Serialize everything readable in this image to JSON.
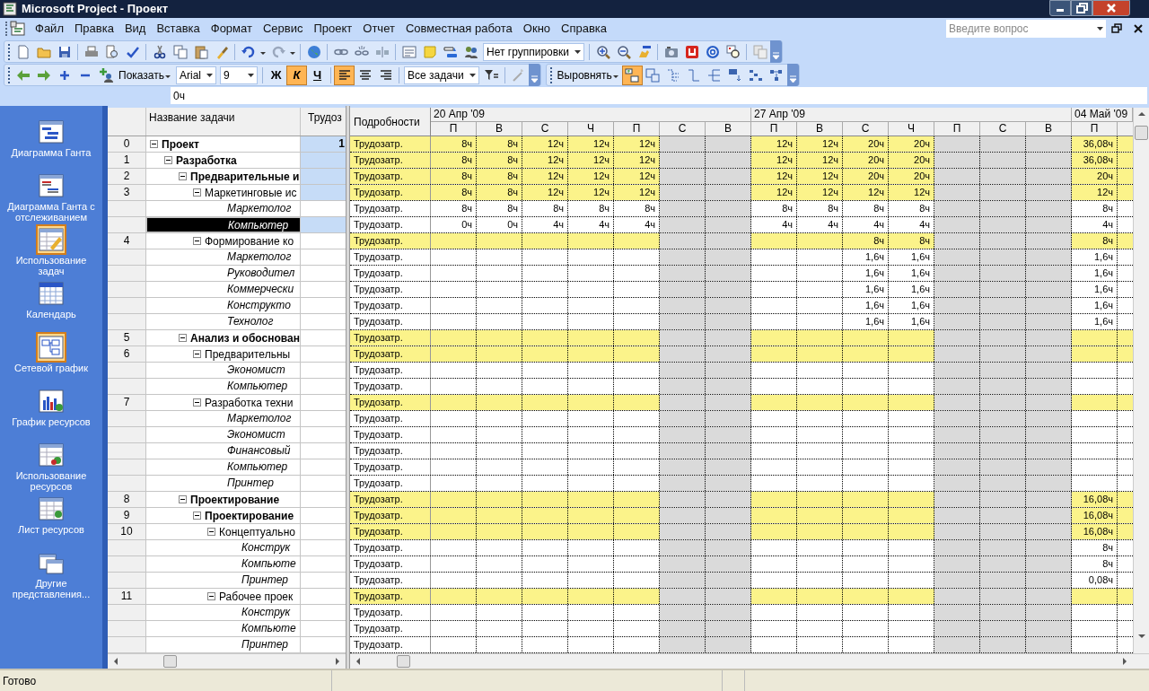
{
  "window": {
    "title": "Microsoft Project - Проект"
  },
  "menu": [
    "Файл",
    "Правка",
    "Вид",
    "Вставка",
    "Формат",
    "Сервис",
    "Проект",
    "Отчет",
    "Совместная работа",
    "Окно",
    "Справка"
  ],
  "help_search": {
    "placeholder": "Введите вопрос"
  },
  "standard_toolbar": {
    "grouping": "Нет группировки"
  },
  "formatting_toolbar": {
    "show_label": "Показать",
    "font": "Arial",
    "font_size": "9",
    "styles": [
      {
        "label": "Ж",
        "pressed": false
      },
      {
        "label": "К",
        "pressed": true
      },
      {
        "label": "Ч",
        "pressed": false
      }
    ],
    "alignment": [
      {
        "selected": true
      },
      {
        "selected": false
      },
      {
        "selected": false
      }
    ],
    "filter": "Все задачи"
  },
  "network_toolbar": {
    "align_label": "Выровнять",
    "tools": [
      {
        "pressed": true
      },
      {
        "pressed": false
      },
      {
        "pressed": false
      },
      {
        "pressed": false
      },
      {
        "pressed": false
      },
      {
        "pressed": false
      },
      {
        "pressed": false
      },
      {
        "pressed": false
      }
    ]
  },
  "entry_bar": {
    "value": "0ч"
  },
  "view_bar": [
    {
      "label": "Диаграмма Ганта",
      "selected": false
    },
    {
      "label": "Диаграмма Ганта с отслеживанием",
      "selected": false
    },
    {
      "label": "Использование задач",
      "selected": true
    },
    {
      "label": "Календарь",
      "selected": false
    },
    {
      "label": "Сетевой график",
      "selected": true
    },
    {
      "label": "График ресурсов",
      "selected": false
    },
    {
      "label": "Использование ресурсов",
      "selected": false
    },
    {
      "label": "Лист ресурсов",
      "selected": false
    },
    {
      "label": "Другие представления...",
      "selected": false
    }
  ],
  "table": {
    "columns": [
      "Название задачи",
      "Трудоз"
    ],
    "tasks": [
      {
        "kind": "task",
        "id": "0",
        "name": "Проект",
        "bold": true,
        "expanded": true,
        "highlighted": true,
        "selected": false,
        "work": "1",
        "detail": "Трудозатр.",
        "cells": [
          "8ч",
          "8ч",
          "12ч",
          "12ч",
          "12ч",
          null,
          null,
          "12ч",
          "12ч",
          "20ч",
          "20ч",
          null,
          null,
          null,
          "36,08ч"
        ],
        "children": [
          {
            "kind": "task",
            "id": "1",
            "name": "Разработка",
            "bold": true,
            "expanded": true,
            "highlighted": true,
            "selected": false,
            "detail": "Трудозатр.",
            "cells": [
              "8ч",
              "8ч",
              "12ч",
              "12ч",
              "12ч",
              null,
              null,
              "12ч",
              "12ч",
              "20ч",
              "20ч",
              null,
              null,
              null,
              "36,08ч"
            ],
            "children": [
              {
                "kind": "task",
                "id": "2",
                "name": "Предварительные и",
                "bold": true,
                "expanded": true,
                "highlighted": true,
                "selected": false,
                "detail": "Трудозатр.",
                "cells": [
                  "8ч",
                  "8ч",
                  "12ч",
                  "12ч",
                  "12ч",
                  null,
                  null,
                  "12ч",
                  "12ч",
                  "20ч",
                  "20ч",
                  null,
                  null,
                  null,
                  "20ч"
                ],
                "children": [
                  {
                    "kind": "task",
                    "id": "3",
                    "name": "Маркетинговые ис",
                    "bold": false,
                    "expanded": true,
                    "highlighted": true,
                    "selected": false,
                    "detail": "Трудозатр.",
                    "cells": [
                      "8ч",
                      "8ч",
                      "12ч",
                      "12ч",
                      "12ч",
                      null,
                      null,
                      "12ч",
                      "12ч",
                      "12ч",
                      "12ч",
                      null,
                      null,
                      null,
                      "12ч"
                    ],
                    "children": [
                      {
                        "kind": "assignment",
                        "name": "Маркетолог",
                        "highlighted": false,
                        "selected": false,
                        "detail": "Трудозатр.",
                        "cells": [
                          "8ч",
                          "8ч",
                          "8ч",
                          "8ч",
                          "8ч",
                          null,
                          null,
                          "8ч",
                          "8ч",
                          "8ч",
                          "8ч",
                          null,
                          null,
                          null,
                          "8ч"
                        ]
                      },
                      {
                        "kind": "assignment",
                        "name": "Компьютер",
                        "highlighted": true,
                        "selected": true,
                        "detail": "Трудозатр.",
                        "cells": [
                          "0ч",
                          "0ч",
                          "4ч",
                          "4ч",
                          "4ч",
                          null,
                          null,
                          "4ч",
                          "4ч",
                          "4ч",
                          "4ч",
                          null,
                          null,
                          null,
                          "4ч"
                        ]
                      }
                    ]
                  },
                  {
                    "kind": "task",
                    "id": "4",
                    "name": "Формирование ко",
                    "bold": false,
                    "expanded": true,
                    "highlighted": false,
                    "selected": false,
                    "detail": "Трудозатр.",
                    "cells": [
                      null,
                      null,
                      null,
                      null,
                      null,
                      null,
                      null,
                      null,
                      null,
                      "8ч",
                      "8ч",
                      null,
                      null,
                      null,
                      "8ч"
                    ],
                    "children": [
                      {
                        "kind": "assignment",
                        "name": "Маркетолог",
                        "highlighted": false,
                        "selected": false,
                        "detail": "Трудозатр.",
                        "cells": [
                          null,
                          null,
                          null,
                          null,
                          null,
                          null,
                          null,
                          null,
                          null,
                          "1,6ч",
                          "1,6ч",
                          null,
                          null,
                          null,
                          "1,6ч"
                        ]
                      },
                      {
                        "kind": "assignment",
                        "name": "Руководител",
                        "highlighted": false,
                        "selected": false,
                        "detail": "Трудозатр.",
                        "cells": [
                          null,
                          null,
                          null,
                          null,
                          null,
                          null,
                          null,
                          null,
                          null,
                          "1,6ч",
                          "1,6ч",
                          null,
                          null,
                          null,
                          "1,6ч"
                        ]
                      },
                      {
                        "kind": "assignment",
                        "name": "Коммерчески",
                        "highlighted": false,
                        "selected": false,
                        "detail": "Трудозатр.",
                        "cells": [
                          null,
                          null,
                          null,
                          null,
                          null,
                          null,
                          null,
                          null,
                          null,
                          "1,6ч",
                          "1,6ч",
                          null,
                          null,
                          null,
                          "1,6ч"
                        ]
                      },
                      {
                        "kind": "assignment",
                        "name": "Конструкто",
                        "highlighted": false,
                        "selected": false,
                        "detail": "Трудозатр.",
                        "cells": [
                          null,
                          null,
                          null,
                          null,
                          null,
                          null,
                          null,
                          null,
                          null,
                          "1,6ч",
                          "1,6ч",
                          null,
                          null,
                          null,
                          "1,6ч"
                        ]
                      },
                      {
                        "kind": "assignment",
                        "name": "Технолог",
                        "highlighted": false,
                        "selected": false,
                        "detail": "Трудозатр.",
                        "cells": [
                          null,
                          null,
                          null,
                          null,
                          null,
                          null,
                          null,
                          null,
                          null,
                          "1,6ч",
                          "1,6ч",
                          null,
                          null,
                          null,
                          "1,6ч"
                        ]
                      }
                    ]
                  }
                ]
              },
              {
                "kind": "task",
                "id": "5",
                "name": "Анализ и обоснован",
                "bold": true,
                "expanded": true,
                "highlighted": false,
                "selected": false,
                "detail": "Трудозатр.",
                "children": [
                  {
                    "kind": "task",
                    "id": "6",
                    "name": "Предварительны",
                    "bold": false,
                    "expanded": true,
                    "highlighted": false,
                    "selected": false,
                    "detail": "Трудозатр.",
                    "children": [
                      {
                        "kind": "assignment",
                        "name": "Экономист",
                        "highlighted": false,
                        "selected": false,
                        "detail": "Трудозатр."
                      },
                      {
                        "kind": "assignment",
                        "name": "Компьютер",
                        "highlighted": false,
                        "selected": false,
                        "detail": "Трудозатр."
                      }
                    ]
                  },
                  {
                    "kind": "task",
                    "id": "7",
                    "name": "Разработка техни",
                    "bold": false,
                    "expanded": true,
                    "highlighted": false,
                    "selected": false,
                    "detail": "Трудозатр.",
                    "children": [
                      {
                        "kind": "assignment",
                        "name": "Маркетолог",
                        "highlighted": false,
                        "selected": false,
                        "detail": "Трудозатр."
                      },
                      {
                        "kind": "assignment",
                        "name": "Экономист",
                        "highlighted": false,
                        "selected": false,
                        "detail": "Трудозатр."
                      },
                      {
                        "kind": "assignment",
                        "name": "Финансовый",
                        "highlighted": false,
                        "selected": false,
                        "detail": "Трудозатр."
                      },
                      {
                        "kind": "assignment",
                        "name": "Компьютер",
                        "highlighted": false,
                        "selected": false,
                        "detail": "Трудозатр."
                      },
                      {
                        "kind": "assignment",
                        "name": "Принтер",
                        "highlighted": false,
                        "selected": false,
                        "detail": "Трудозатр."
                      }
                    ]
                  }
                ]
              },
              {
                "kind": "task",
                "id": "8",
                "name": "Проектирование",
                "bold": true,
                "expanded": true,
                "highlighted": false,
                "selected": false,
                "detail": "Трудозатр.",
                "cells": [
                  null,
                  null,
                  null,
                  null,
                  null,
                  null,
                  null,
                  null,
                  null,
                  null,
                  null,
                  null,
                  null,
                  null,
                  "16,08ч"
                ],
                "children": [
                  {
                    "kind": "task",
                    "id": "9",
                    "name": "Проектирование",
                    "bold": true,
                    "expanded": true,
                    "highlighted": false,
                    "selected": false,
                    "detail": "Трудозатр.",
                    "cells": [
                      null,
                      null,
                      null,
                      null,
                      null,
                      null,
                      null,
                      null,
                      null,
                      null,
                      null,
                      null,
                      null,
                      null,
                      "16,08ч"
                    ],
                    "children": [
                      {
                        "kind": "task",
                        "id": "10",
                        "name": "Концептуально",
                        "bold": false,
                        "expanded": true,
                        "highlighted": false,
                        "selected": false,
                        "detail": "Трудозатр.",
                        "cells": [
                          null,
                          null,
                          null,
                          null,
                          null,
                          null,
                          null,
                          null,
                          null,
                          null,
                          null,
                          null,
                          null,
                          null,
                          "16,08ч"
                        ],
                        "children": [
                          {
                            "kind": "assignment",
                            "name": "Конструк",
                            "highlighted": false,
                            "selected": false,
                            "detail": "Трудозатр.",
                            "cells": [
                              null,
                              null,
                              null,
                              null,
                              null,
                              null,
                              null,
                              null,
                              null,
                              null,
                              null,
                              null,
                              null,
                              null,
                              "8ч"
                            ]
                          },
                          {
                            "kind": "assignment",
                            "name": "Компьюте",
                            "highlighted": false,
                            "selected": false,
                            "detail": "Трудозатр.",
                            "cells": [
                              null,
                              null,
                              null,
                              null,
                              null,
                              null,
                              null,
                              null,
                              null,
                              null,
                              null,
                              null,
                              null,
                              null,
                              "8ч"
                            ]
                          },
                          {
                            "kind": "assignment",
                            "name": "Принтер",
                            "highlighted": false,
                            "selected": false,
                            "detail": "Трудозатр.",
                            "cells": [
                              null,
                              null,
                              null,
                              null,
                              null,
                              null,
                              null,
                              null,
                              null,
                              null,
                              null,
                              null,
                              null,
                              null,
                              "0,08ч"
                            ]
                          }
                        ]
                      },
                      {
                        "kind": "task",
                        "id": "11",
                        "name": "Рабочее проек",
                        "bold": false,
                        "expanded": true,
                        "highlighted": false,
                        "selected": false,
                        "detail": "Трудозатр.",
                        "children": [
                          {
                            "kind": "assignment",
                            "name": "Конструк",
                            "highlighted": false,
                            "selected": false,
                            "detail": "Трудозатр."
                          },
                          {
                            "kind": "assignment",
                            "name": "Компьюте",
                            "highlighted": false,
                            "selected": false,
                            "detail": "Трудозатр."
                          },
                          {
                            "kind": "assignment",
                            "name": "Принтер",
                            "highlighted": false,
                            "selected": false,
                            "detail": "Трудозатр."
                          }
                        ]
                      }
                    ]
                  }
                ]
              }
            ]
          }
        ]
      }
    ]
  },
  "usage": {
    "detail_header": "Подробности",
    "weeks": [
      {
        "label": "20 Апр '09",
        "days": [
          {
            "label": "П",
            "working": true
          },
          {
            "label": "В",
            "working": true
          },
          {
            "label": "С",
            "working": true
          },
          {
            "label": "Ч",
            "working": true
          },
          {
            "label": "П",
            "working": true
          },
          {
            "label": "С",
            "working": false
          },
          {
            "label": "В",
            "working": false
          }
        ]
      },
      {
        "label": "27 Апр '09",
        "days": [
          {
            "label": "П",
            "working": true
          },
          {
            "label": "В",
            "working": true
          },
          {
            "label": "С",
            "working": true
          },
          {
            "label": "Ч",
            "working": true
          },
          {
            "label": "П",
            "working": false
          },
          {
            "label": "С",
            "working": false
          },
          {
            "label": "В",
            "working": false
          }
        ]
      },
      {
        "label": "04 Май '09",
        "days": [
          {
            "label": "П",
            "working": true
          }
        ]
      }
    ]
  },
  "status_bar": "Готово"
}
